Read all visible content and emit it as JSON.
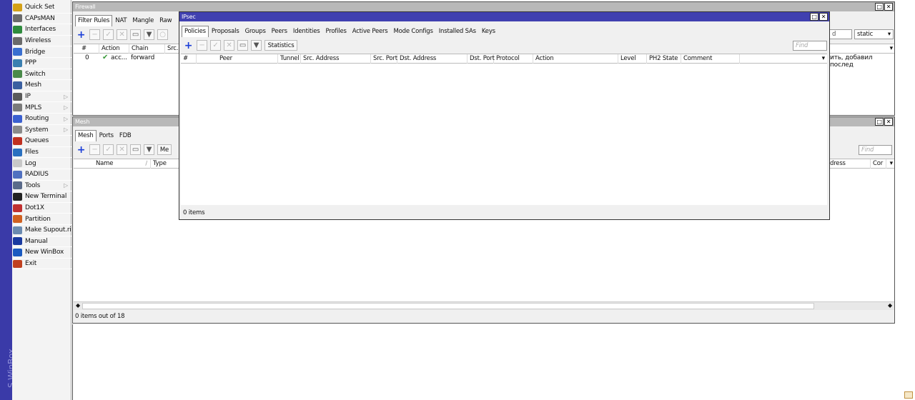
{
  "app": {
    "side_title": "S WinBox"
  },
  "menu": [
    {
      "label": "Quick Set",
      "icon": "magic-wand-icon",
      "color": "#d4a017",
      "arrow": false
    },
    {
      "label": "CAPsMAN",
      "icon": "antenna-icon",
      "color": "#6a6a6a",
      "arrow": false
    },
    {
      "label": "Interfaces",
      "icon": "interfaces-icon",
      "color": "#2e8b3d",
      "arrow": false
    },
    {
      "label": "Wireless",
      "icon": "wireless-icon",
      "color": "#6a6a6a",
      "arrow": false
    },
    {
      "label": "Bridge",
      "icon": "bridge-icon",
      "color": "#3a6fd0",
      "arrow": false
    },
    {
      "label": "PPP",
      "icon": "ppp-icon",
      "color": "#3a7fb0",
      "arrow": false
    },
    {
      "label": "Switch",
      "icon": "switch-icon",
      "color": "#4a8a4a",
      "arrow": false
    },
    {
      "label": "Mesh",
      "icon": "mesh-icon",
      "color": "#3a5fa0",
      "arrow": false
    },
    {
      "label": "IP",
      "icon": "ip-icon",
      "color": "#5a5a5a",
      "arrow": true
    },
    {
      "label": "MPLS",
      "icon": "mpls-icon",
      "color": "#7a7a7a",
      "arrow": true
    },
    {
      "label": "Routing",
      "icon": "routing-icon",
      "color": "#3a5fd0",
      "arrow": true
    },
    {
      "label": "System",
      "icon": "system-icon",
      "color": "#8a8a8a",
      "arrow": true
    },
    {
      "label": "Queues",
      "icon": "queues-icon",
      "color": "#c03020",
      "arrow": false
    },
    {
      "label": "Files",
      "icon": "folder-icon",
      "color": "#2a70c0",
      "arrow": false
    },
    {
      "label": "Log",
      "icon": "log-icon",
      "color": "#c8c8c8",
      "arrow": false
    },
    {
      "label": "RADIUS",
      "icon": "radius-icon",
      "color": "#5070c0",
      "arrow": false
    },
    {
      "label": "Tools",
      "icon": "tools-icon",
      "color": "#5a6a8a",
      "arrow": true
    },
    {
      "label": "New Terminal",
      "icon": "terminal-icon",
      "color": "#222222",
      "arrow": false
    },
    {
      "label": "Dot1X",
      "icon": "dot1x-icon",
      "color": "#c03030",
      "arrow": false
    },
    {
      "label": "Partition",
      "icon": "partition-icon",
      "color": "#d06020",
      "arrow": false
    },
    {
      "label": "Make Supout.rif",
      "icon": "supout-icon",
      "color": "#6a8ab0",
      "arrow": false
    },
    {
      "label": "Manual",
      "icon": "manual-icon",
      "color": "#1a3aa0",
      "arrow": false
    },
    {
      "label": "New WinBox",
      "icon": "winbox-icon",
      "color": "#1a5ac0",
      "arrow": false
    },
    {
      "label": "Exit",
      "icon": "exit-icon",
      "color": "#c04020",
      "arrow": false
    }
  ],
  "firewall": {
    "title": "Firewall",
    "tabs": [
      "Filter Rules",
      "NAT",
      "Mangle",
      "Raw"
    ],
    "columns": [
      "#",
      "Action",
      "Chain",
      "Src."
    ],
    "row": {
      "num": "0",
      "action": "acc...",
      "chain": "forward"
    },
    "right_field": "d",
    "right_select": "static",
    "right_comment": "ить, добавил послед"
  },
  "mesh": {
    "title": "Mesh",
    "tabs": [
      "Mesh",
      "Ports",
      "FDB"
    ],
    "toolbar_label": "Me",
    "columns": [
      "Name",
      "Type"
    ],
    "right_columns": [
      "dress",
      "Cor"
    ],
    "find_placeholder": "Find",
    "status": "0 items out of 18"
  },
  "ipsec": {
    "title": "IPsec",
    "tabs": [
      "Policies",
      "Proposals",
      "Groups",
      "Peers",
      "Identities",
      "Profiles",
      "Active Peers",
      "Mode Configs",
      "Installed SAs",
      "Keys"
    ],
    "statistics_label": "Statistics",
    "find_placeholder": "Find",
    "columns": [
      "#",
      "Peer",
      "Tunnel",
      "Src. Address",
      "Src. Port",
      "Dst. Address",
      "Dst. Port",
      "Protocol",
      "Action",
      "Level",
      "PH2 State",
      "Comment"
    ],
    "status": "0 items"
  },
  "window_buttons": {
    "maximize": "□",
    "close": "✕"
  }
}
